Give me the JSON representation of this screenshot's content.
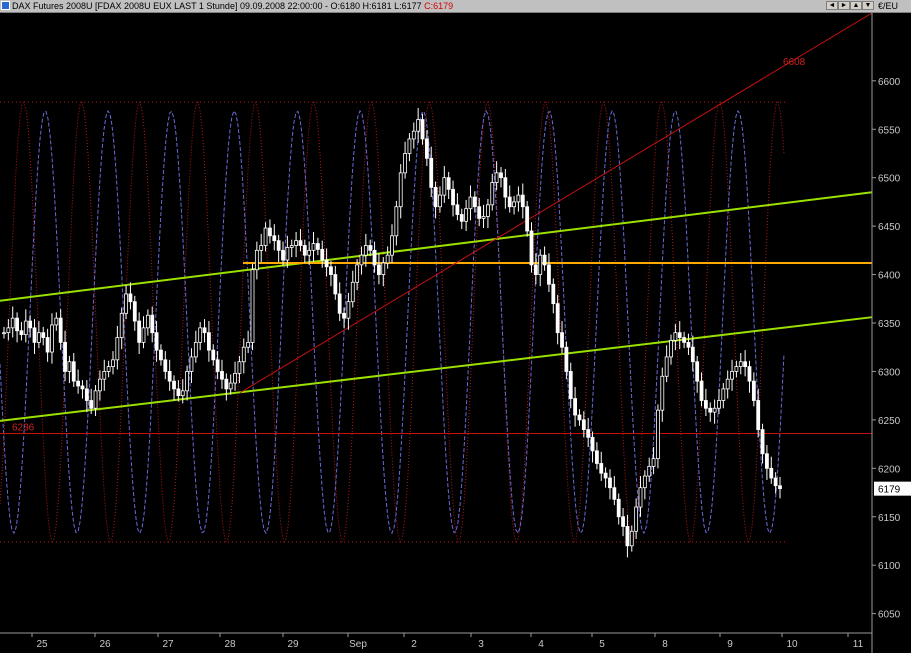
{
  "window": {
    "title_prefix": "DAX Futures 2008U [FDAX 2008U EUX LAST 1 Stunde] 09.09.2008 22:00:00 - O:6180 H:6181 L:6177 ",
    "title_close": "C:6179",
    "currency": "€/EU",
    "buttons": [
      "◄",
      "►",
      "▲",
      "▼"
    ]
  },
  "colors": {
    "background": "#000000",
    "candles": "#ffffff",
    "oscillator_fast": "#b81818",
    "oscillator_slow": "#6a6ad8",
    "channel_line": "#9be000",
    "horizontal_level": "#ffaa00",
    "resistance_support": "#c81010"
  },
  "chart_data": {
    "type": "candlestick",
    "instrument": "DAX Futures 2008U",
    "timeframe": "1 Stunde",
    "y_axis": {
      "ylim": [
        6030,
        6670
      ],
      "ticks": [
        6050,
        6100,
        6150,
        6200,
        6250,
        6300,
        6350,
        6400,
        6450,
        6500,
        6550,
        6600
      ],
      "last_price_label": "6179"
    },
    "x_axis": {
      "labels": [
        "25",
        "26",
        "27",
        "28",
        "29",
        "Sep",
        "2",
        "3",
        "4",
        "5",
        "8",
        "9",
        "10",
        "11"
      ]
    },
    "annotations": {
      "level_upper_label": "6608",
      "level_lower_label": "6236",
      "horizontal_lines": [
        6236,
        6412
      ],
      "dotted_bounds": [
        6578,
        6124
      ]
    },
    "ohlc_close_path": [
      6340,
      6345,
      6355,
      6342,
      6338,
      6352,
      6345,
      6330,
      6340,
      6335,
      6320,
      6348,
      6355,
      6330,
      6300,
      6310,
      6290,
      6285,
      6282,
      6270,
      6262,
      6280,
      6292,
      6300,
      6305,
      6312,
      6335,
      6360,
      6380,
      6372,
      6352,
      6330,
      6345,
      6358,
      6340,
      6322,
      6312,
      6300,
      6290,
      6282,
      6275,
      6280,
      6300,
      6315,
      6330,
      6345,
      6340,
      6322,
      6312,
      6300,
      6292,
      6282,
      6288,
      6298,
      6310,
      6325,
      6330,
      6405,
      6425,
      6430,
      6448,
      6440,
      6435,
      6425,
      6415,
      6428,
      6430,
      6435,
      6430,
      6420,
      6425,
      6432,
      6426,
      6415,
      6408,
      6400,
      6380,
      6360,
      6355,
      6372,
      6392,
      6410,
      6420,
      6430,
      6425,
      6410,
      6400,
      6412,
      6420,
      6440,
      6470,
      6505,
      6525,
      6540,
      6548,
      6560,
      6540,
      6520,
      6490,
      6470,
      6482,
      6500,
      6488,
      6472,
      6462,
      6455,
      6468,
      6480,
      6470,
      6458,
      6460,
      6472,
      6495,
      6505,
      6500,
      6480,
      6470,
      6475,
      6482,
      6470,
      6445,
      6410,
      6400,
      6420,
      6410,
      6390,
      6370,
      6340,
      6325,
      6300,
      6272,
      6255,
      6250,
      6240,
      6232,
      6218,
      6205,
      6195,
      6190,
      6180,
      6168,
      6150,
      6140,
      6120,
      6135,
      6160,
      6180,
      6192,
      6202,
      6210,
      6260,
      6295,
      6315,
      6332,
      6340,
      6335,
      6330,
      6325,
      6310,
      6290,
      6270,
      6262,
      6258,
      6262,
      6270,
      6282,
      6292,
      6300,
      6305,
      6310,
      6305,
      6290,
      6270,
      6240,
      6215,
      6200,
      6190,
      6182,
      6179
    ]
  }
}
